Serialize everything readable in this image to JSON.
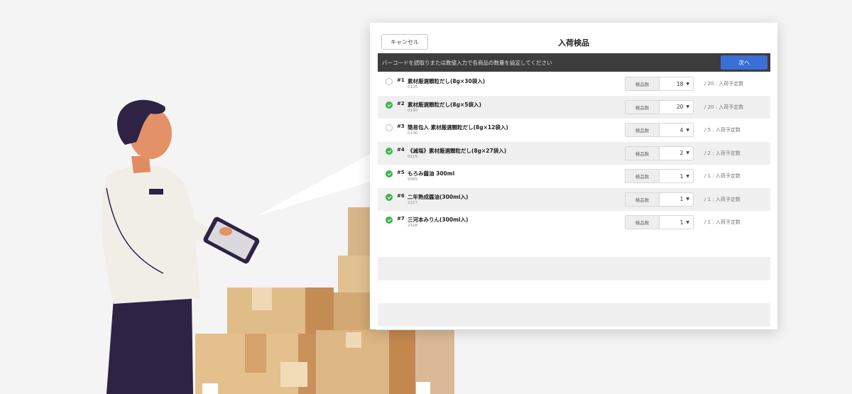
{
  "panel": {
    "title": "入荷検品",
    "cancel_label": "キャンセル",
    "scan_message": "バーコードを読取りまたは数値入力で各商品の数量を設定してください",
    "next_label": "次へ"
  },
  "columns": {
    "inspect_label": "検品数",
    "planned_suffix": "入荷予定数"
  },
  "items": [
    {
      "num": "#1",
      "name": "素材厳選顆粒だし(8g×30袋入)",
      "code": "0105",
      "checked": false,
      "qty": "18",
      "planned": "/ 20 : 入荷予定数"
    },
    {
      "num": "#2",
      "name": "素材厳選顆粒だし(8g×5袋入)",
      "code": "0130",
      "checked": true,
      "qty": "20",
      "planned": "/ 20 : 入荷予定数"
    },
    {
      "num": "#3",
      "name": "簡易包入 素材厳選顆粒だし(8g×12袋入)",
      "code": "0136",
      "checked": false,
      "qty": "4",
      "planned": "/ 5 : 入荷予定数"
    },
    {
      "num": "#4",
      "name": "《減塩》素材厳選顆粒だし(8g×27袋入)",
      "code": "0115",
      "checked": true,
      "qty": "2",
      "planned": "/ 2 : 入荷予定数"
    },
    {
      "num": "#5",
      "name": "もろみ醤油 300ml",
      "code": "5065",
      "checked": true,
      "qty": "1",
      "planned": "/ 1 : 入荷予定数"
    },
    {
      "num": "#6",
      "name": "二年熟成醤油(300ml入)",
      "code": "2227",
      "checked": true,
      "qty": "1",
      "planned": "/ 1 : 入荷予定数"
    },
    {
      "num": "#7",
      "name": "三河本みりん(300ml入)",
      "code": "2328",
      "checked": true,
      "qty": "1",
      "planned": "/ 1 : 入荷予定数"
    }
  ],
  "colors": {
    "accent": "#3a6fd8",
    "check": "#3cb54a",
    "scan_bar": "#3d3d3d"
  }
}
